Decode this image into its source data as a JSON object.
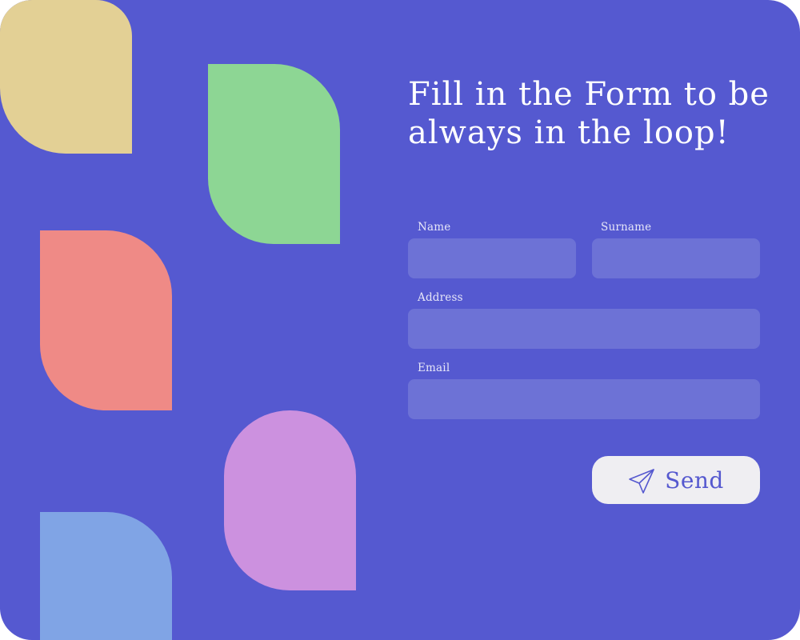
{
  "form": {
    "title": "Fill in the Form to be always in the loop!",
    "fields": {
      "name": {
        "label": "Name",
        "value": "",
        "placeholder": ""
      },
      "surname": {
        "label": "Surname",
        "value": "",
        "placeholder": ""
      },
      "address": {
        "label": "Address",
        "value": "",
        "placeholder": ""
      },
      "email": {
        "label": "Email",
        "value": "",
        "placeholder": ""
      }
    },
    "send_button": {
      "label": "Send",
      "icon": "paper-plane-icon"
    }
  },
  "colors": {
    "background": "#5559d0",
    "input_background": "#6d72d6",
    "button_background": "#efeef2",
    "accent_text": "#5558cf",
    "shape_yellow": "#e3d095",
    "shape_green": "#8dd694",
    "shape_red": "#ef8a86",
    "shape_purple": "#cc91df",
    "shape_blue": "#80a4e5"
  }
}
